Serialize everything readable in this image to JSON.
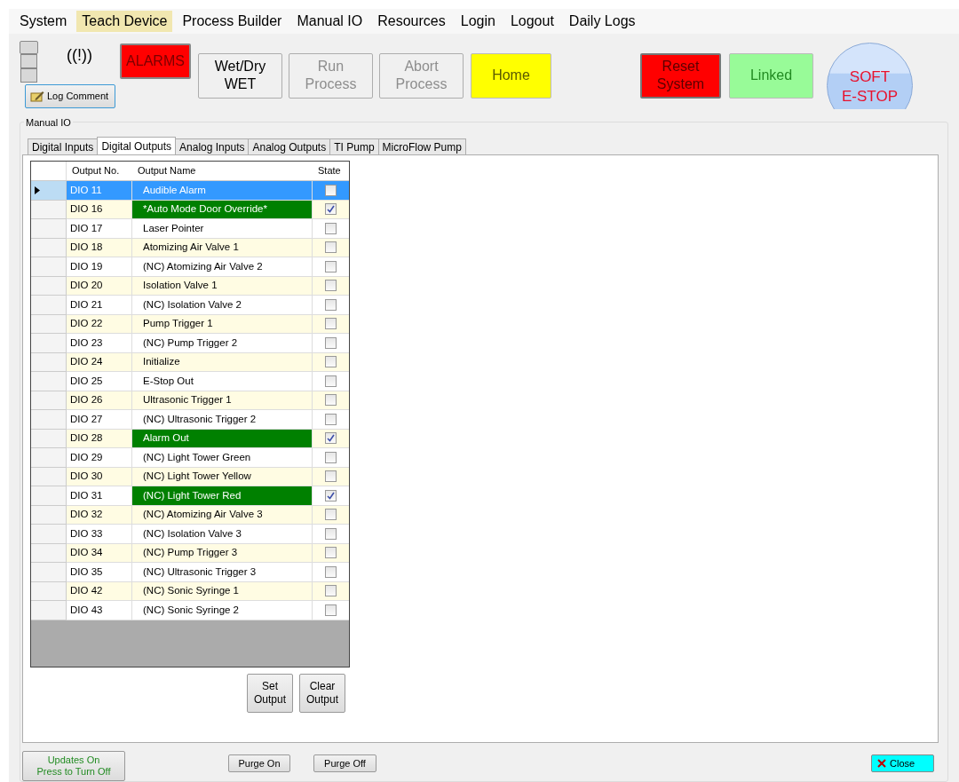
{
  "menu": [
    {
      "label": "System",
      "selected": false
    },
    {
      "label": "Teach Device",
      "selected": true
    },
    {
      "label": "Process Builder",
      "selected": false
    },
    {
      "label": "Manual IO",
      "selected": false
    },
    {
      "label": "Resources",
      "selected": false
    },
    {
      "label": "Login",
      "selected": false
    },
    {
      "label": "Logout",
      "selected": false
    },
    {
      "label": "Daily Logs",
      "selected": false
    }
  ],
  "alarm_indicator": "((!))",
  "log_comment": "Log Comment",
  "toolbar": [
    {
      "kind": "alarm",
      "label": "ALARMS",
      "disabled": false
    },
    {
      "kind": "plain",
      "label": "Wet/Dry\nWET",
      "disabled": false
    },
    {
      "kind": "plain",
      "label": "Run\nProcess",
      "disabled": true
    },
    {
      "kind": "plain",
      "label": "Abort\nProcess",
      "disabled": true
    },
    {
      "kind": "home",
      "label": "Home",
      "disabled": false
    },
    {
      "kind": "reset",
      "label": "Reset\nSystem",
      "disabled": false
    },
    {
      "kind": "linked",
      "label": "Linked",
      "disabled": false
    },
    {
      "kind": "estop",
      "label": "SOFT\nE-STOP",
      "disabled": false
    }
  ],
  "group_title": "Manual IO",
  "tabs": [
    {
      "label": "Digital Inputs",
      "selected": false
    },
    {
      "label": "Digital Outputs",
      "selected": true
    },
    {
      "label": "Analog Inputs",
      "selected": false
    },
    {
      "label": "Analog Outputs",
      "selected": false
    },
    {
      "label": "TI Pump",
      "selected": false
    },
    {
      "label": "MicroFlow Pump",
      "selected": false
    }
  ],
  "table": {
    "columns": [
      "Output No.",
      "Output Name",
      "State"
    ],
    "rows": [
      {
        "number": "DIO 11",
        "name": "Audible Alarm",
        "checked": false,
        "selected": true
      },
      {
        "number": "DIO 16",
        "name": "*Auto Mode Door Override*",
        "checked": true,
        "selected": false
      },
      {
        "number": "DIO 17",
        "name": "Laser Pointer",
        "checked": false,
        "selected": false
      },
      {
        "number": "DIO 18",
        "name": "Atomizing Air Valve 1",
        "checked": false,
        "selected": false
      },
      {
        "number": "DIO 19",
        "name": "(NC) Atomizing Air Valve 2",
        "checked": false,
        "selected": false
      },
      {
        "number": "DIO 20",
        "name": "Isolation Valve 1",
        "checked": false,
        "selected": false
      },
      {
        "number": "DIO 21",
        "name": "(NC) Isolation Valve 2",
        "checked": false,
        "selected": false
      },
      {
        "number": "DIO 22",
        "name": "Pump Trigger 1",
        "checked": false,
        "selected": false
      },
      {
        "number": "DIO 23",
        "name": "(NC) Pump Trigger 2",
        "checked": false,
        "selected": false
      },
      {
        "number": "DIO 24",
        "name": "Initialize",
        "checked": false,
        "selected": false
      },
      {
        "number": "DIO 25",
        "name": "E-Stop Out",
        "checked": false,
        "selected": false
      },
      {
        "number": "DIO 26",
        "name": "Ultrasonic Trigger 1",
        "checked": false,
        "selected": false
      },
      {
        "number": "DIO 27",
        "name": "(NC) Ultrasonic Trigger 2",
        "checked": false,
        "selected": false
      },
      {
        "number": "DIO 28",
        "name": "Alarm Out",
        "checked": true,
        "selected": false
      },
      {
        "number": "DIO 29",
        "name": "(NC) Light Tower Green",
        "checked": false,
        "selected": false
      },
      {
        "number": "DIO 30",
        "name": "(NC) Light Tower Yellow",
        "checked": false,
        "selected": false
      },
      {
        "number": "DIO 31",
        "name": "(NC) Light Tower Red",
        "checked": true,
        "selected": false
      },
      {
        "number": "DIO 32",
        "name": "(NC) Atomizing Air Valve 3",
        "checked": false,
        "selected": false
      },
      {
        "number": "DIO 33",
        "name": "(NC) Isolation Valve 3",
        "checked": false,
        "selected": false
      },
      {
        "number": "DIO 34",
        "name": "(NC) Pump Trigger 3",
        "checked": false,
        "selected": false
      },
      {
        "number": "DIO 35",
        "name": "(NC) Ultrasonic Trigger 3",
        "checked": false,
        "selected": false
      },
      {
        "number": "DIO 42",
        "name": "(NC) Sonic Syringe 1",
        "checked": false,
        "selected": false
      },
      {
        "number": "DIO 43",
        "name": "(NC) Sonic Syringe 2",
        "checked": false,
        "selected": false
      }
    ]
  },
  "set_output": "Set\nOutput",
  "clear_output": "Clear\nOutput",
  "updates_button": "Updates On\nPress to Turn Off",
  "purge_on": "Purge On",
  "purge_off": "Purge Off",
  "close": "Close"
}
